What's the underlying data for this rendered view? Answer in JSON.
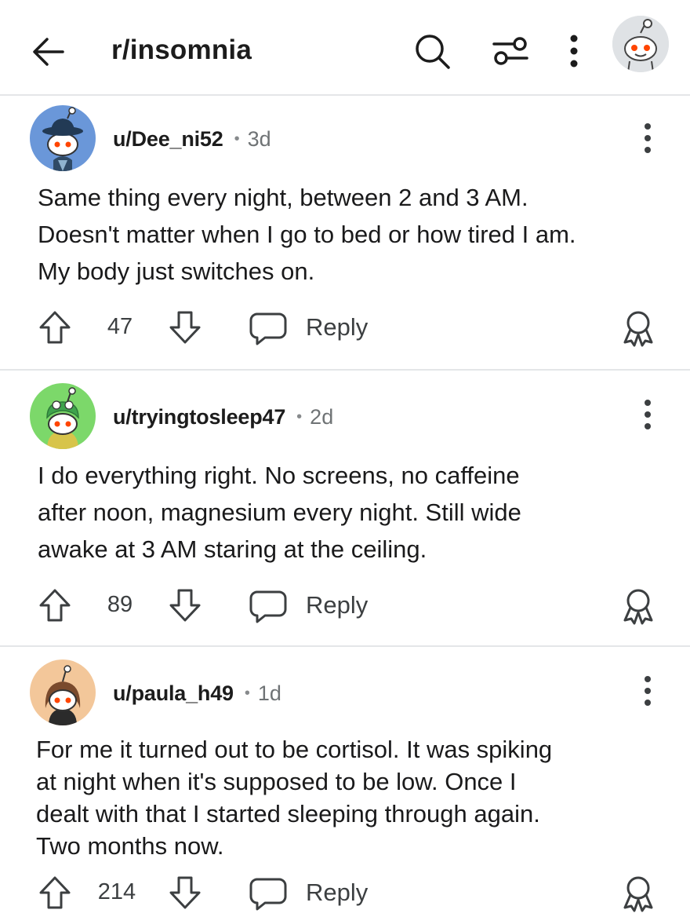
{
  "header": {
    "back_icon": "arrow-left-icon",
    "title": "r/insomnia",
    "search_icon": "search-icon",
    "filter_icon": "sliders-icon",
    "more_icon": "vertical-dots-icon",
    "avatar_icon": "snoo-avatar-icon"
  },
  "colors": {
    "divider": "#e4e6e8",
    "text": "#1a1a1b",
    "muted": "#6f7375",
    "snoo_eye": "#ff4500"
  },
  "comments": [
    {
      "username": "u/Dee_ni52",
      "age": "3d",
      "body": "Same thing every night, between 2 and 3 AM. Doesn't matter when I go to bed or how tired I am. My body just switches on.",
      "body_lines": [
        "Same thing every night, between 2 and 3 AM.",
        "Doesn't matter when I go to bed or how tired I am.",
        "My body just switches on."
      ],
      "score": "47",
      "reply_label": "Reply",
      "avatar_bg": "#6a97d9"
    },
    {
      "username": "u/tryingtosleep47",
      "age": "2d",
      "body": "I do everything right. No screens, no caffeine after noon, magnesium every night. Still wide awake at 3 AM staring at the ceiling.",
      "body_lines": [
        "I do everything right. No screens, no caffeine",
        "after noon, magnesium every night. Still wide",
        "awake at 3 AM staring at the ceiling."
      ],
      "score": "89",
      "reply_label": "Reply",
      "avatar_bg": "#7cd86a"
    },
    {
      "username": "u/paula_h49",
      "age": "1d",
      "body": "For me it turned out to be cortisol. It was spiking at night when it's supposed to be low. Once I dealt with that I started sleeping through again. Two months now.",
      "body_lines": [
        "For me it turned out to be cortisol. It was spiking",
        "at night when it's supposed to be low. Once I",
        "dealt with that I started sleeping through again.",
        "Two months now."
      ],
      "score": "214",
      "reply_label": "Reply",
      "avatar_bg": "#f3c79a"
    }
  ]
}
